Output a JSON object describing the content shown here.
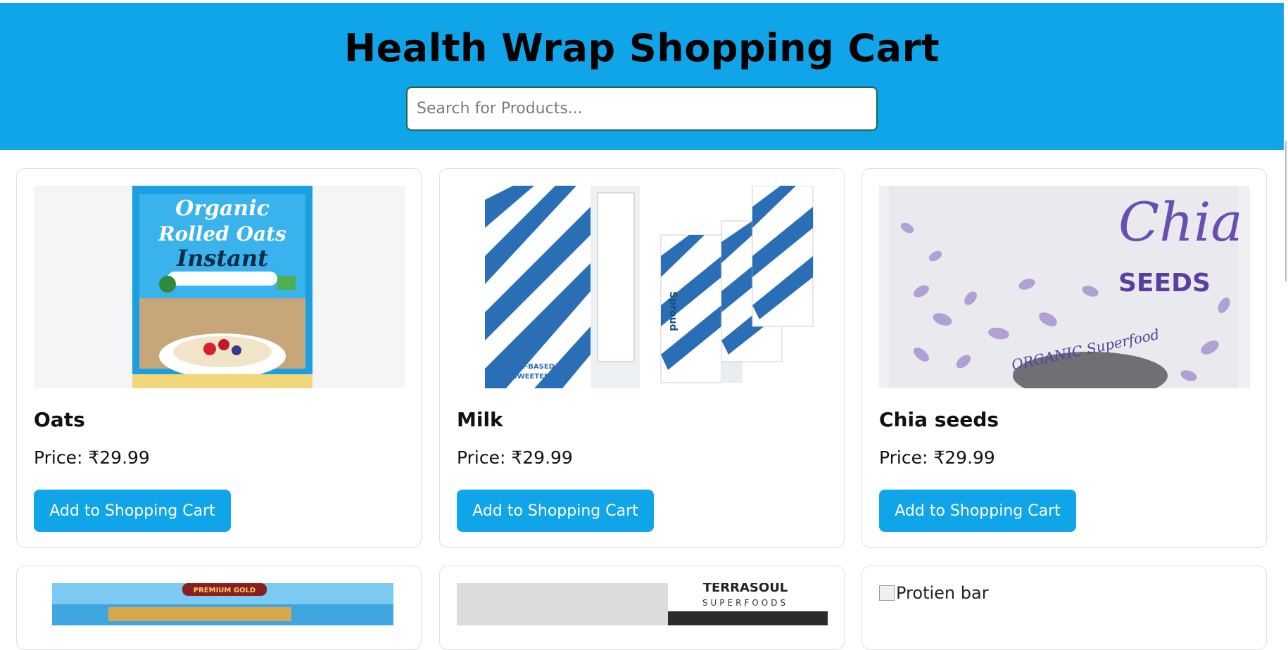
{
  "header": {
    "title": "Health Wrap Shopping Cart",
    "search_placeholder": "Search for Products..."
  },
  "colors": {
    "brand_blue": "#10a4e8",
    "search_border": "#196b47"
  },
  "products": [
    {
      "name": "Oats",
      "price": "Price: ₹29.99",
      "button": "Add to Shopping Cart",
      "image": "organic-rolled-oats-bag",
      "image_text": [
        "Organic",
        "Rolled Oats",
        "Instant"
      ]
    },
    {
      "name": "Milk",
      "price": "Price: ₹29.99",
      "button": "Add to Shopping Cart",
      "image": "sproud-pea-milk-cartons",
      "image_text": [
        "Sproud",
        "PLANT-BASED MILK",
        "UNSWEETENED"
      ]
    },
    {
      "name": "Chia seeds",
      "price": "Price: ₹29.99",
      "button": "Add to Shopping Cart",
      "image": "chia-seeds-pouch",
      "image_text": [
        "Chia",
        "SEEDS",
        "ORGANIC Superfood"
      ]
    },
    {
      "image": "soya-chunks-bag",
      "image_text": [
        "PREMIUM GOLD"
      ]
    },
    {
      "image": "superfoods-pouch",
      "image_text": [
        "TERRASOUL",
        "SUPERFOODS"
      ]
    },
    {
      "image_alt": "Protien bar"
    }
  ]
}
